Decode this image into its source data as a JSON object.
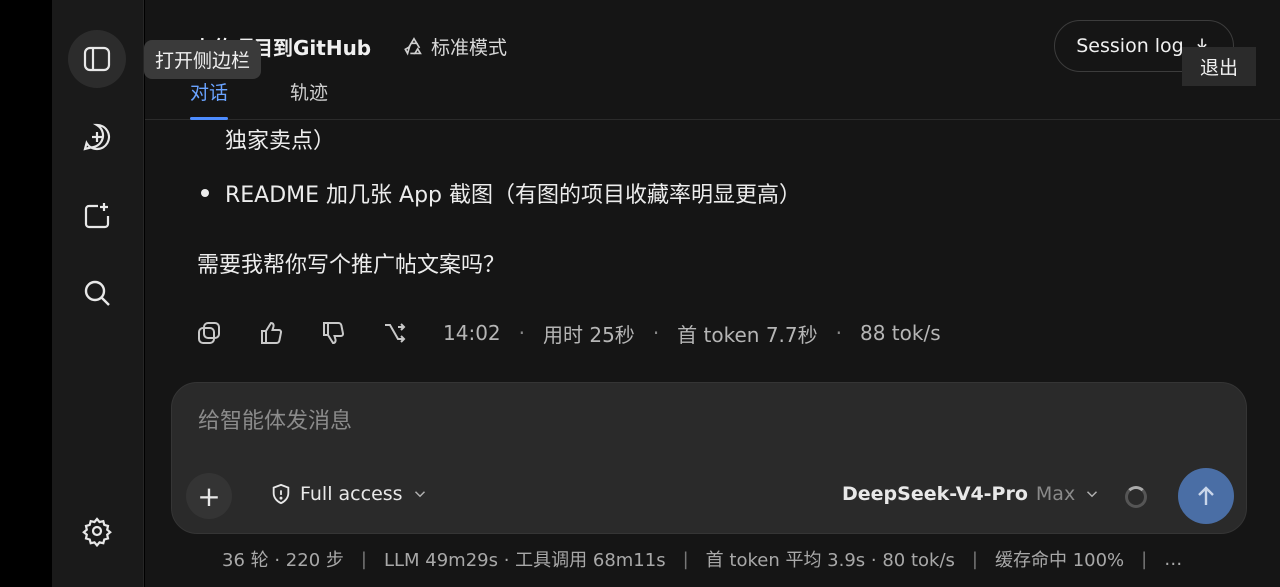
{
  "sidebar": {
    "tooltip": "打开侧边栏",
    "icons": [
      "sidebar-toggle-icon",
      "new-chat-icon",
      "add-folder-icon",
      "search-icon",
      "settings-icon"
    ]
  },
  "header": {
    "title": "上传项目到GitHub",
    "mode_label": "标准模式",
    "tabs": [
      {
        "label": "对话",
        "active": true
      },
      {
        "label": "轨迹",
        "active": false
      }
    ],
    "session_log_label": "Session log",
    "exit_label": "退出"
  },
  "message": {
    "partial_line": "独家卖点）",
    "bullet": "README 加几张 App 截图（有图的项目收藏率明显更高）",
    "closing": "需要我帮你写个推广帖文案吗？"
  },
  "meta": {
    "time": "14:02",
    "duration": "用时 25秒",
    "first_token": "首 token 7.7秒",
    "speed": "88 tok/s",
    "separator": "·"
  },
  "composer": {
    "placeholder": "给智能体发消息",
    "access_label": "Full access",
    "model_name": "DeepSeek-V4-Pro",
    "effort_label": "Max"
  },
  "status": {
    "turns": "36 轮 · 220 步",
    "llm": "LLM 49m29s · 工具调用 68m11s",
    "token_avg": "首 token 平均 3.9s · 80 tok/s",
    "cache": "缓存命中 100%",
    "more": "…",
    "separator": "|"
  },
  "colors": {
    "accent": "#4d8cff",
    "send_button": "#4a6ea5",
    "background": "#151515",
    "sidebar": "#1a1a1a"
  }
}
